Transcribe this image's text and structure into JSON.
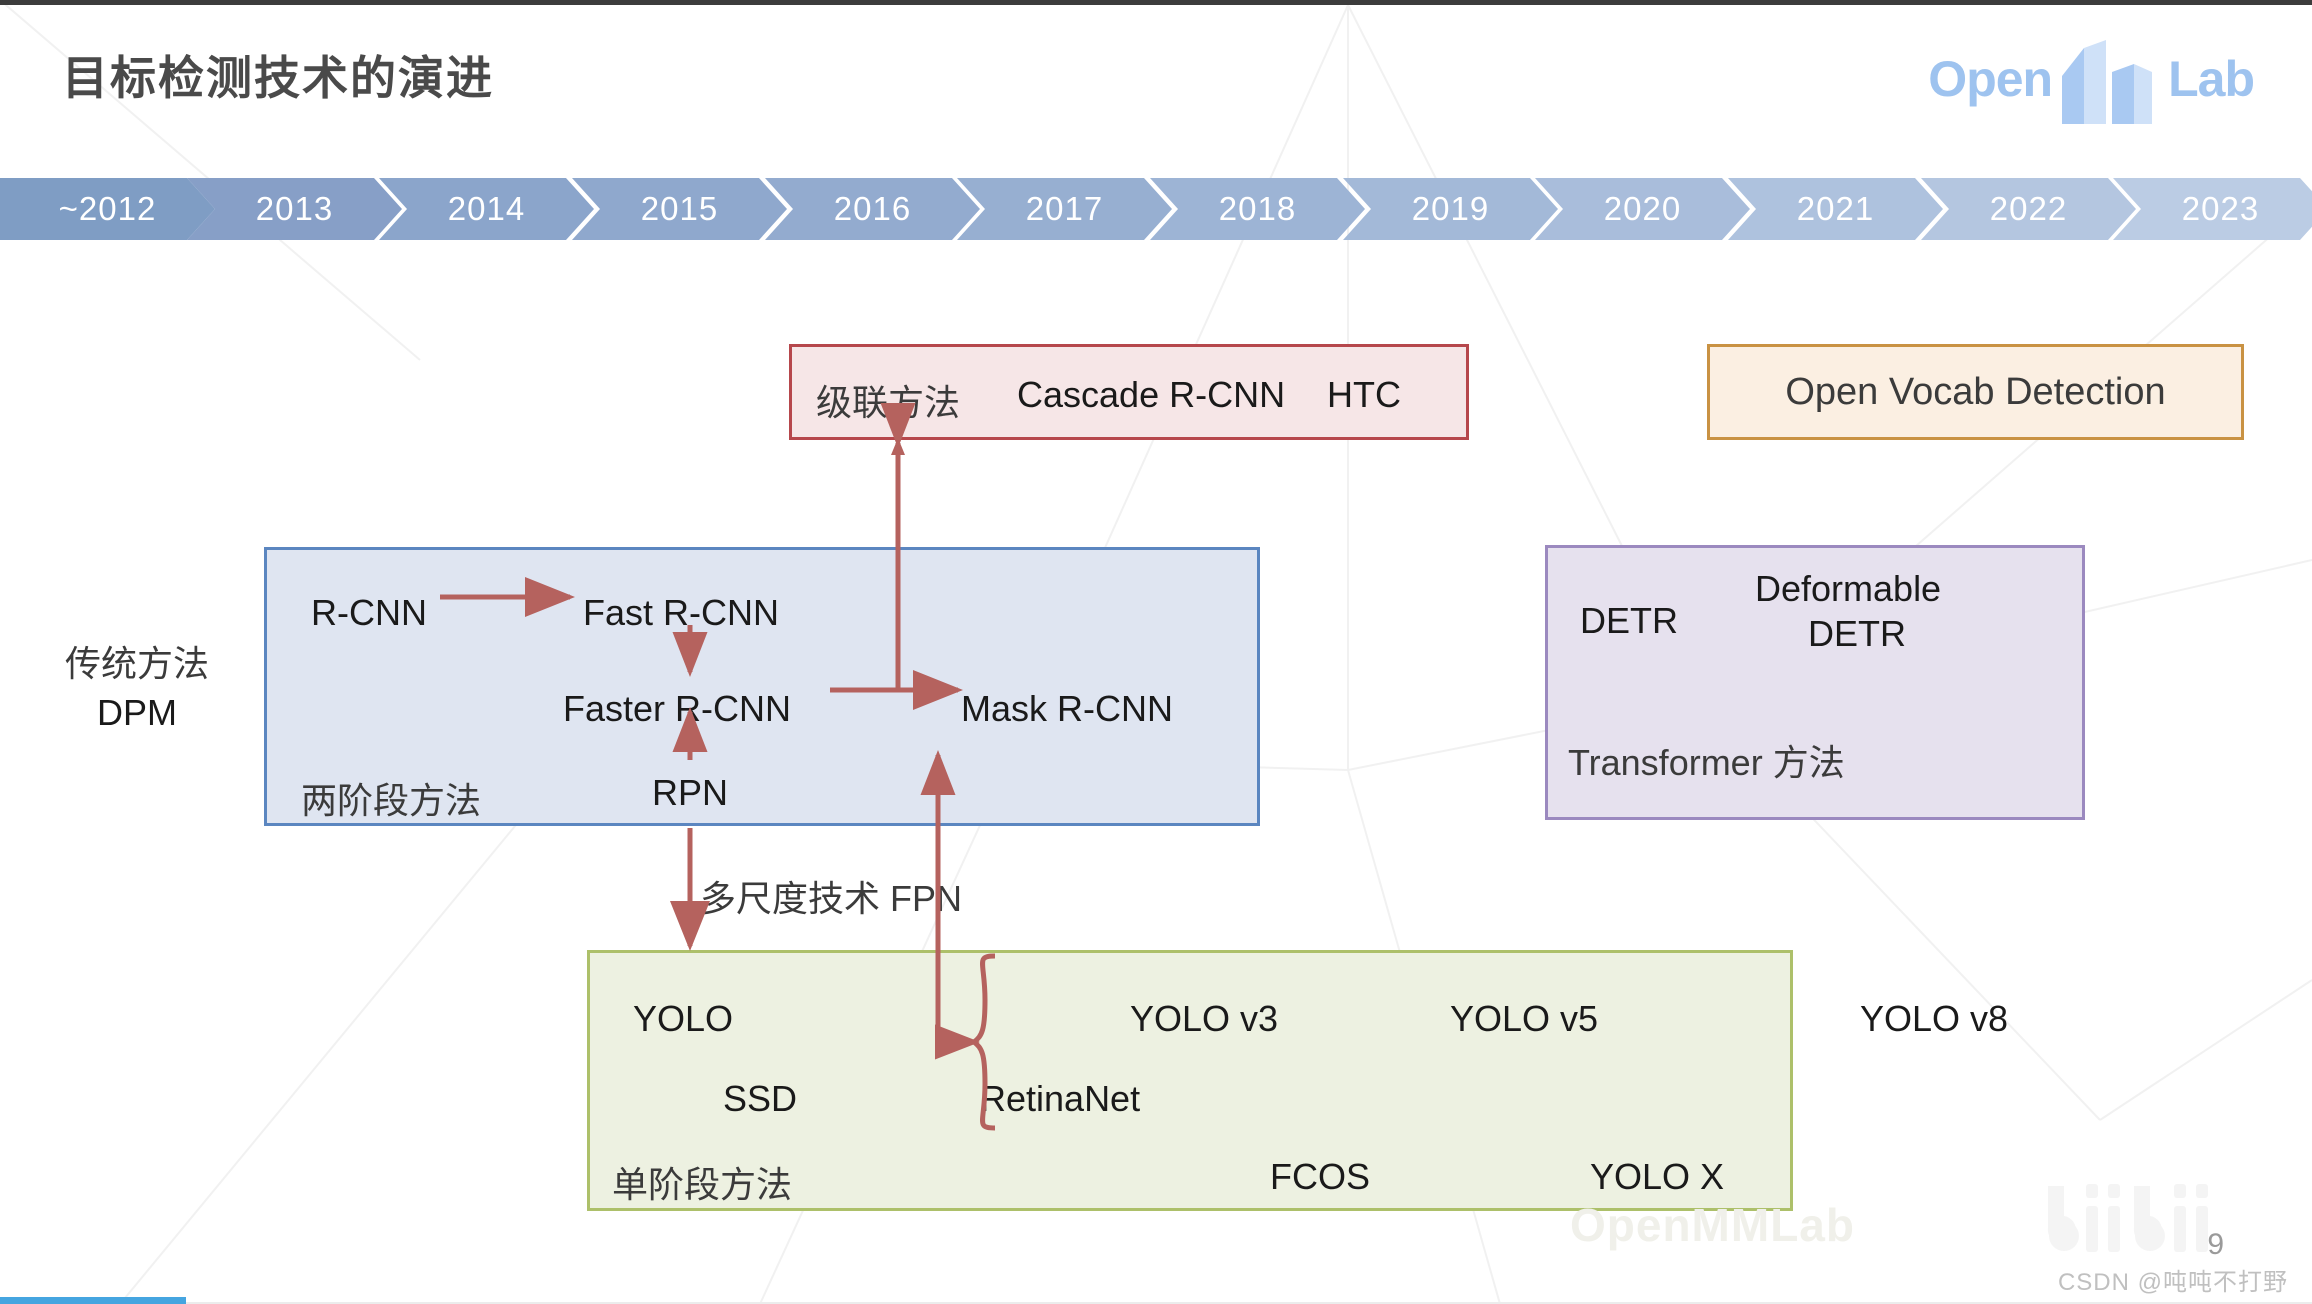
{
  "slide": {
    "title": "目标检测技术的演进",
    "page_number": "9",
    "footer_credit": "CSDN @吨吨不打野",
    "watermark": "OpenMMLab",
    "logo": {
      "open": "Open",
      "mm": "MM",
      "lab": "Lab"
    }
  },
  "timeline": {
    "items": [
      {
        "label": "~2012",
        "color": "#7f9dc4"
      },
      {
        "label": "2013",
        "color": "#879fc7"
      },
      {
        "label": "2014",
        "color": "#8ba5cb"
      },
      {
        "label": "2015",
        "color": "#8fa8cd"
      },
      {
        "label": "2016",
        "color": "#93abcf"
      },
      {
        "label": "2017",
        "color": "#97afd1"
      },
      {
        "label": "2018",
        "color": "#9db4d5"
      },
      {
        "label": "2019",
        "color": "#a3b9d8"
      },
      {
        "label": "2020",
        "color": "#a9bddb"
      },
      {
        "label": "2021",
        "color": "#aec2de"
      },
      {
        "label": "2022",
        "color": "#b4c6e0"
      },
      {
        "label": "2023",
        "color": "#bbcce4"
      }
    ]
  },
  "traditional": {
    "group_label": "传统方法",
    "method": "DPM"
  },
  "cascade_box": {
    "group_label": "级联方法",
    "methods": [
      "Cascade R-CNN",
      "HTC"
    ],
    "border_color": "#b6474c",
    "fill_color": "#f6e6e7"
  },
  "open_vocab_box": {
    "label": "Open Vocab Detection",
    "border_color": "#c99243",
    "fill_color": "#fbefe2"
  },
  "two_stage_box": {
    "group_label": "两阶段方法",
    "methods": {
      "rcnn": "R-CNN",
      "fast_rcnn": "Fast R-CNN",
      "faster_rcnn": "Faster R-CNN",
      "mask_rcnn": "Mask R-CNN",
      "rpn": "RPN"
    },
    "border_color": "#5b86c0",
    "fill_color": "#dfe5f1"
  },
  "transformer_box": {
    "group_label": "Transformer 方法",
    "methods": {
      "detr": "DETR",
      "deformable_detr_line1": "Deformable",
      "deformable_detr_line2": "DETR"
    },
    "border_color": "#9b89bf",
    "fill_color": "#e6e1ee"
  },
  "single_stage_box": {
    "group_label": "单阶段方法",
    "methods": {
      "yolo": "YOLO",
      "ssd": "SSD",
      "retinanet": "RetinaNet",
      "yolo_v3": "YOLO v3",
      "yolo_v5": "YOLO v5",
      "yolo_v8": "YOLO v8",
      "fcos": "FCOS",
      "yolo_x": "YOLO X"
    },
    "border_color": "#adc06a",
    "fill_color": "#edf1e1"
  },
  "connectors": {
    "fpn_label": "多尺度技术 FPN",
    "arrow_color": "#b5625e"
  }
}
